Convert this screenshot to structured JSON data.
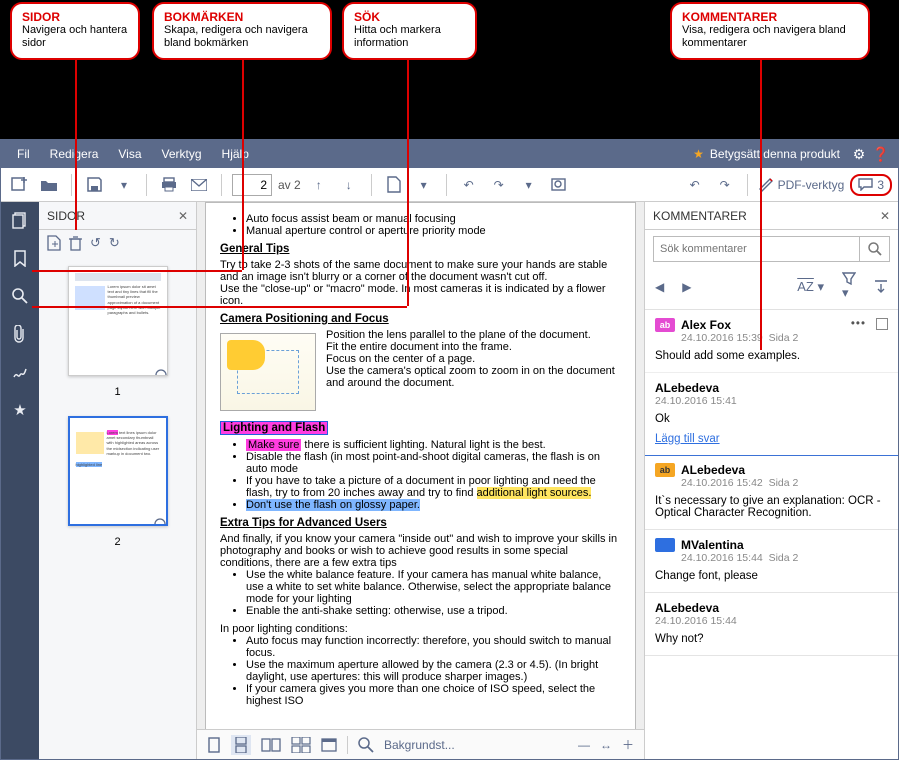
{
  "callouts": {
    "sidor": {
      "title": "SIDOR",
      "desc": "Navigera och hantera sidor"
    },
    "bokmarken": {
      "title": "BOKMÄRKEN",
      "desc": "Skapa, redigera och navigera bland bokmärken"
    },
    "sok": {
      "title": "SÖK",
      "desc": "Hitta och markera information"
    },
    "kommentarer": {
      "title": "KOMMENTARER",
      "desc": "Visa, redigera och navigera bland kommentarer"
    }
  },
  "menu": {
    "fil": "Fil",
    "redigera": "Redigera",
    "visa": "Visa",
    "verktyg": "Verktyg",
    "hjalp": "Hjälp",
    "rate": "Betygsätt denna produkt"
  },
  "toolbar": {
    "page_current": "2",
    "page_sep": "av 2",
    "pdf_tools": "PDF-verktyg",
    "comment_count": "3"
  },
  "sidebar": {
    "title": "SIDOR",
    "page1": "1",
    "page2": "2"
  },
  "doc": {
    "b1": "Auto focus assist beam or manual focusing",
    "b2": "Manual aperture control or aperture priority mode",
    "h_general": "General Tips",
    "p_general": "Try to take 2-3 shots of the same document to make sure your hands are stable and an image isn't blurry or a corner of the document wasn't cut off.",
    "p_general2": "Use the \"close-up\" or \"macro\" mode. In most cameras it is indicated by a flower icon.",
    "h_camera": "Camera Positioning and Focus",
    "c1": "Position the lens parallel to the plane of the document.",
    "c2": "Fit the entire document into the frame.",
    "c3": "Focus on the center of a page.",
    "c4": "Use the camera's optical zoom to zoom in on the document and around the document.",
    "h_light_lbl": "Lighting and Flash",
    "l1a": "Make sure",
    "l1b": " there is sufficient lighting. Natural light is the best.",
    "l2": "Disable the flash (in most point-and-shoot digital cameras, the flash is on auto mode",
    "l3a": "If you have to take a picture of a document in poor lighting and need the flash, try to from 20 inches away and try to find ",
    "l3b": "additional light sources.",
    "l4": "Don't use the flash on glossy paper.",
    "h_extra": "Extra Tips for Advanced Users",
    "p_extra": "And finally, if you know your camera \"inside out\" and wish to improve your skills in photography and books or wish to achieve good results in some special conditions, there are a few extra tips",
    "e1": "Use the white balance feature. If your camera has manual white balance, use a white to set white balance. Otherwise, select the appropriate balance mode for your lighting",
    "e2": "Enable the anti-shake setting: otherwise, use a tripod.",
    "p_poor": "In poor lighting conditions:",
    "p1": "Auto focus may function incorrectly: therefore, you should switch to manual focus.",
    "p2": "Use the maximum aperture allowed by the camera (2.3 or 4.5). (In bright daylight, use apertures: this will produce sharper images.)",
    "p3": "If your camera gives you more than one choice of ISO speed, select the highest ISO"
  },
  "viewbar": {
    "bg": "Bakgrundst..."
  },
  "comments_panel": {
    "title": "KOMMENTARER",
    "search_placeholder": "Sök kommentarer",
    "sort": "AZ",
    "items": [
      {
        "badge": "ab",
        "badge_color": "pink",
        "user": "Alex Fox",
        "meta": "24.10.2016 15:39",
        "page": "Sida 2",
        "body": "Should add some examples.",
        "reply_user": "ALebedeva",
        "reply_meta": "24.10.2016 15:41",
        "reply_body": "Ok",
        "add_reply": "Lägg till svar"
      },
      {
        "badge": "ab",
        "badge_color": "orange",
        "user": "ALebedeva",
        "meta": "24.10.2016 15:42",
        "page": "Sida 2",
        "body": "It`s necessary to give an explanation: OCR - Optical Character Recognition."
      },
      {
        "badge": "",
        "badge_color": "blue",
        "user": "MValentina",
        "meta": "24.10.2016 15:44",
        "page": "Sida 2",
        "body": "Change font, please"
      },
      {
        "badge": "",
        "badge_color": "",
        "user": "ALebedeva",
        "meta": "24.10.2016 15:44",
        "page": "",
        "body": "Why not?"
      }
    ]
  }
}
